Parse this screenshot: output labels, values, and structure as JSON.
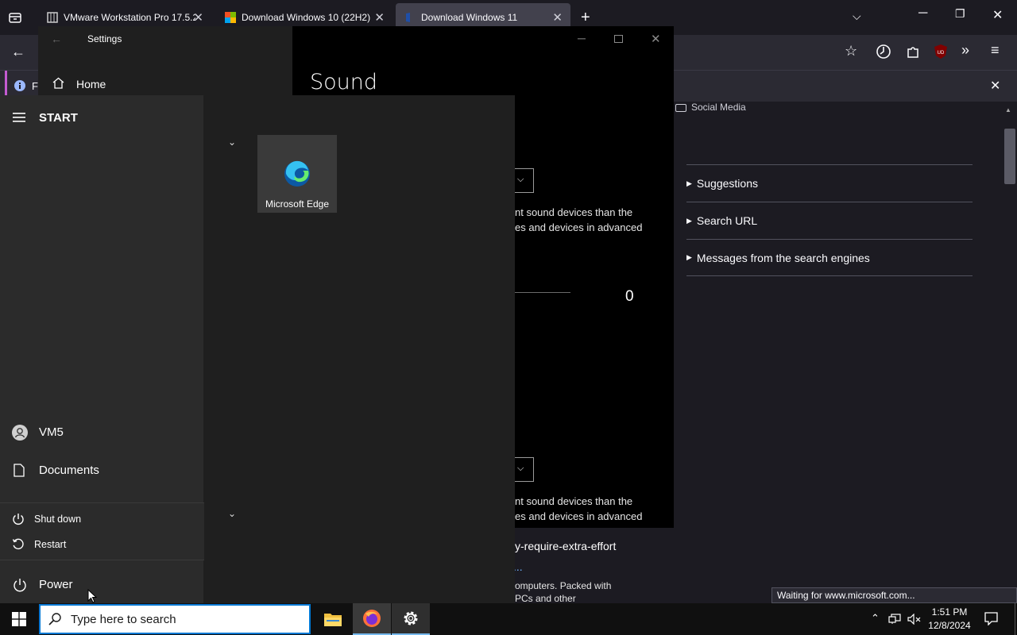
{
  "browser": {
    "tabs": [
      {
        "label": "VMware Workstation Pro 17.5.2"
      },
      {
        "label": "Download Windows 10 (22H2)"
      },
      {
        "label": "Download Windows 11"
      }
    ],
    "notification_fragment": "Fi"
  },
  "page": {
    "social_media": "Social Media",
    "accordion": [
      "Suggestions",
      "Search URL",
      "Messages from the search engines"
    ],
    "status": "Waiting for www.microsoft.com...",
    "link_fragment": "y-require-extra-effort",
    "ellipsis": "...",
    "text_fragment_1": "omputers. Packed with",
    "text_fragment_2": "PCs and other"
  },
  "settings": {
    "title": "Settings",
    "home": "Home",
    "heading": "Sound",
    "fragment_a1": "nt sound devices than the",
    "fragment_a2": "es and devices in advanced",
    "volume_value": "0",
    "fragment_b1": "nt sound devices than the",
    "fragment_b2": "es and devices in advanced"
  },
  "start_menu": {
    "header": "START",
    "tile_label": "Microsoft Edge",
    "user": "VM5",
    "documents": "Documents",
    "shutdown": "Shut down",
    "restart": "Restart",
    "power": "Power"
  },
  "taskbar": {
    "search_placeholder": "Type here to search",
    "time": "1:51 PM",
    "date": "12/8/2024"
  },
  "colors": {
    "accent": "#0078d4",
    "browser_bg": "#1c1b22",
    "start_bg": "#2b2b2b"
  }
}
